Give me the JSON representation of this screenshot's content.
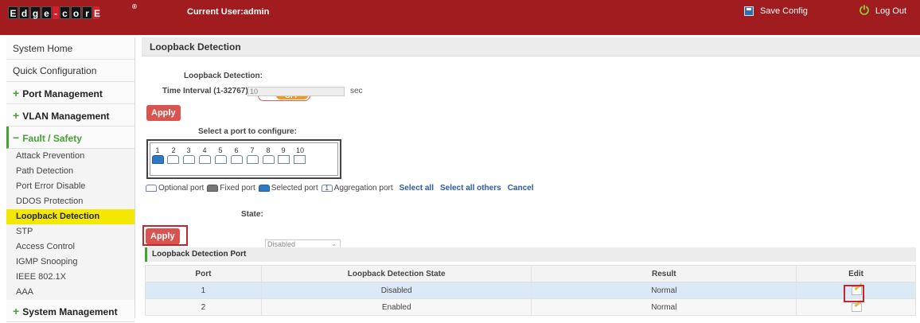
{
  "header": {
    "logo_text": "Edge-core",
    "current_user": "Current User:admin",
    "save_config": "Save Config",
    "logout": "Log Out"
  },
  "sidebar": {
    "system_home": "System Home",
    "quick_configuration": "Quick Configuration",
    "port_management": "Port Management",
    "vlan_management": "VLAN Management",
    "fault_safety": "Fault / Safety",
    "fault_items": [
      "Attack Prevention",
      "Path Detection",
      "Port Error Disable",
      "DDOS Protection",
      "Loopback Detection",
      "STP",
      "Access Control",
      "IGMP Snooping",
      "IEEE 802.1X",
      "AAA"
    ],
    "system_management": "System Management",
    "plus": "+",
    "minus": "−"
  },
  "content": {
    "title": "Loopback Detection",
    "loopback_label": "Loopback Detection:",
    "toggle_state": "OFF",
    "interval_label": "Time Interval (1-32767):",
    "interval_value": "10",
    "interval_unit": "sec",
    "apply": "Apply",
    "select_port_label": "Select a port to configure:",
    "ports": [
      "1",
      "2",
      "3",
      "4",
      "5",
      "6",
      "7",
      "8",
      "9",
      "10"
    ],
    "selected_port": "1",
    "legend": {
      "optional": "Optional port",
      "fixed": "Fixed port",
      "selected": "Selected port",
      "aggregation_icon": "1",
      "aggregation": "Aggregation port",
      "select_all": "Select all",
      "select_all_others": "Select all others",
      "cancel": "Cancel"
    },
    "state_label": "State:",
    "state_value": "Disabled",
    "section_title": "Loopback Detection Port",
    "table": {
      "headers": [
        "Port",
        "Loopback Detection State",
        "Result",
        "Edit"
      ],
      "rows": [
        {
          "port": "1",
          "state": "Disabled",
          "result": "Normal"
        },
        {
          "port": "2",
          "state": "Enabled",
          "result": "Normal"
        }
      ]
    }
  }
}
